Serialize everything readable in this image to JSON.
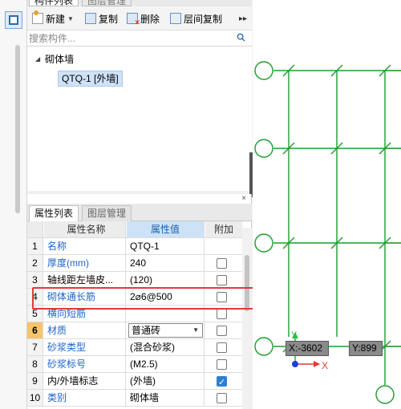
{
  "component_panel": {
    "tabs": [
      "构件列表",
      "图层管理"
    ],
    "toolbar": {
      "new_label": "新建",
      "copy_label": "复制",
      "delete_label": "删除",
      "floor_copy_label": "层间复制",
      "more_label": "▸▸"
    },
    "search_placeholder": "搜索构件...",
    "tree": {
      "parent": "砌体墙",
      "child": "QTQ-1 [外墙]"
    }
  },
  "property_panel": {
    "close_label": "×",
    "tabs": [
      "属性列表",
      "图层管理"
    ],
    "headers": {
      "name": "属性名称",
      "value": "属性值",
      "add": "附加"
    },
    "rows": [
      {
        "num": "1",
        "name": "名称",
        "value": "QTQ-1",
        "checkbox": null
      },
      {
        "num": "2",
        "name": "厚度(mm)",
        "value": "240",
        "checkbox": false
      },
      {
        "num": "3",
        "name": "轴线距左墙皮...",
        "value": "(120)",
        "checkbox": false
      },
      {
        "num": "4",
        "name": "砌体通长筋",
        "value": "2⌀6@500",
        "checkbox": false
      },
      {
        "num": "5",
        "name": "横向短筋",
        "value": "",
        "checkbox": false
      },
      {
        "num": "6",
        "name": "材质",
        "value": "普通砖",
        "checkbox": false
      },
      {
        "num": "7",
        "name": "砂浆类型",
        "value": "(混合砂浆)",
        "checkbox": false
      },
      {
        "num": "8",
        "name": "砂浆标号",
        "value": "(M2.5)",
        "checkbox": false
      },
      {
        "num": "9",
        "name": "内/外墙标志",
        "value": "(外墙)",
        "checkbox": true
      },
      {
        "num": "10",
        "name": "类别",
        "value": "砌体墙",
        "checkbox": false
      }
    ]
  },
  "canvas": {
    "coord_x": "X:-3602",
    "coord_y": "Y:899",
    "axis_x_label": "X",
    "axis_y_label": "Y",
    "grid_color": "#1a9e2a",
    "axis_color": "#e53935"
  },
  "colors": {
    "accent": "#1f64c8",
    "selection": "#cfe2f8",
    "highlight": "#e53935"
  }
}
